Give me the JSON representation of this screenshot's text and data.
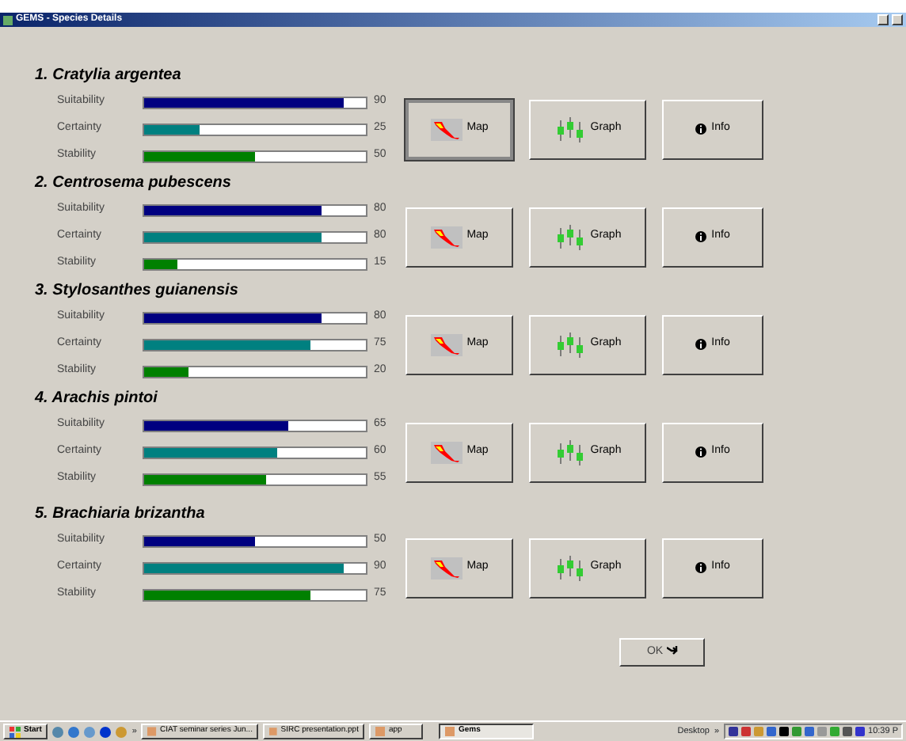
{
  "window": {
    "title": "GEMS - Species Details"
  },
  "species": [
    {
      "title": "1. Cratylia argentea",
      "metrics": [
        {
          "kind": "suitability",
          "label": "Suitability",
          "level": 0.9,
          "reading": "90"
        },
        {
          "kind": "certainty",
          "label": "Certainty",
          "level": 0.25,
          "reading": "25"
        },
        {
          "kind": "stability",
          "label": "Stability",
          "level": 0.5,
          "reading": "50"
        }
      ],
      "buttons": [
        {
          "kind": "map",
          "label": "Map",
          "focused": true
        },
        {
          "kind": "graph",
          "label": "Graph",
          "focused": false
        },
        {
          "kind": "info",
          "label": "Info",
          "focused": false
        }
      ]
    },
    {
      "title": "2. Centrosema pubescens",
      "metrics": [
        {
          "kind": "suitability",
          "label": "Suitability",
          "level": 0.8,
          "reading": "80"
        },
        {
          "kind": "certainty",
          "label": "Certainty",
          "level": 0.8,
          "reading": "80"
        },
        {
          "kind": "stability",
          "label": "Stability",
          "level": 0.15,
          "reading": "15"
        }
      ],
      "buttons": [
        {
          "kind": "map",
          "label": "Map",
          "focused": false
        },
        {
          "kind": "graph",
          "label": "Graph",
          "focused": false
        },
        {
          "kind": "info",
          "label": "Info",
          "focused": false
        }
      ]
    },
    {
      "title": "3. Stylosanthes guianensis",
      "metrics": [
        {
          "kind": "suitability",
          "label": "Suitability",
          "level": 0.8,
          "reading": "80"
        },
        {
          "kind": "certainty",
          "label": "Certainty",
          "level": 0.75,
          "reading": "75"
        },
        {
          "kind": "stability",
          "label": "Stability",
          "level": 0.2,
          "reading": "20"
        }
      ],
      "buttons": [
        {
          "kind": "map",
          "label": "Map",
          "focused": false
        },
        {
          "kind": "graph",
          "label": "Graph",
          "focused": false
        },
        {
          "kind": "info",
          "label": "Info",
          "focused": false
        }
      ]
    },
    {
      "title": "4. Arachis pintoi",
      "metrics": [
        {
          "kind": "suitability",
          "label": "Suitability",
          "level": 0.65,
          "reading": "65"
        },
        {
          "kind": "certainty",
          "label": "Certainty",
          "level": 0.6,
          "reading": "60"
        },
        {
          "kind": "stability",
          "label": "Stability",
          "level": 0.55,
          "reading": "55"
        }
      ],
      "buttons": [
        {
          "kind": "map",
          "label": "Map",
          "focused": false
        },
        {
          "kind": "graph",
          "label": "Graph",
          "focused": false
        },
        {
          "kind": "info",
          "label": "Info",
          "focused": false
        }
      ]
    },
    {
      "title": "5. Brachiaria brizantha",
      "metrics": [
        {
          "kind": "suitability",
          "label": "Suitability",
          "level": 0.5,
          "reading": "50"
        },
        {
          "kind": "certainty",
          "label": "Certainty",
          "level": 0.9,
          "reading": "90"
        },
        {
          "kind": "stability",
          "label": "Stability",
          "level": 0.75,
          "reading": "75"
        }
      ],
      "buttons": [
        {
          "kind": "map",
          "label": "Map",
          "focused": false
        },
        {
          "kind": "graph",
          "label": "Graph",
          "focused": false
        },
        {
          "kind": "info",
          "label": "Info",
          "focused": false
        }
      ]
    }
  ],
  "ok_button": {
    "label": "OK"
  },
  "taskbar": {
    "start": "Start",
    "more": "»",
    "tasks": [
      {
        "label": "CIAT seminar series Jun...",
        "selected": false
      },
      {
        "label": "SIRC presentation.ppt",
        "selected": false
      },
      {
        "label": "app",
        "selected": false
      },
      {
        "label": "Gems",
        "selected": true
      }
    ],
    "desktop": "Desktop",
    "tray_more": "»",
    "clock": "10:39 P"
  }
}
